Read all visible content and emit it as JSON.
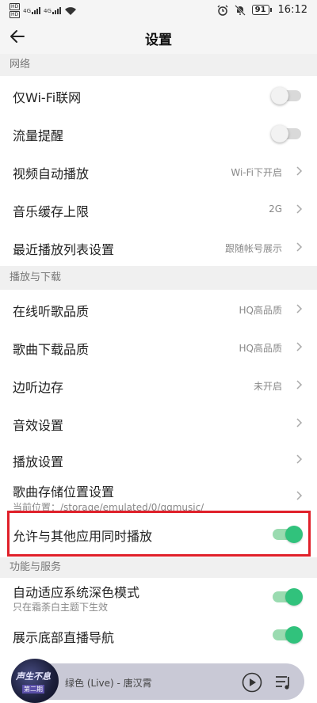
{
  "status_bar": {
    "hd1": "HD",
    "hd2": "HD",
    "net1": "4G",
    "net2": "4G",
    "battery": "91",
    "time": "16:12"
  },
  "header": {
    "title": "设置"
  },
  "sections": {
    "network": {
      "title": "网络",
      "wifi_only": {
        "label": "仅Wi-Fi联网",
        "enabled": false
      },
      "data_alert": {
        "label": "流量提醒",
        "enabled": false
      },
      "video_autoplay": {
        "label": "视频自动播放",
        "value": "Wi-Fi下开启"
      },
      "cache_limit": {
        "label": "音乐缓存上限",
        "value": "2G"
      },
      "recent_playlist": {
        "label": "最近播放列表设置",
        "value": "跟随帐号展示"
      }
    },
    "playback": {
      "title": "播放与下载",
      "online_quality": {
        "label": "在线听歌品质",
        "value": "HQ高品质"
      },
      "download_quality": {
        "label": "歌曲下载品质",
        "value": "HQ高品质"
      },
      "listen_cache": {
        "label": "边听边存",
        "value": "未开启"
      },
      "sound_effects": {
        "label": "音效设置"
      },
      "playback_settings": {
        "label": "播放设置"
      },
      "storage_location": {
        "label": "歌曲存储位置设置",
        "sub": "当前位置：/storage/emulated/0/qqmusic/"
      },
      "allow_other_apps": {
        "label": "允许与其他应用同时播放",
        "enabled": true
      }
    },
    "features": {
      "title": "功能与服务",
      "dark_mode": {
        "label": "自动适应系统深色模式",
        "sub": "只在霜荼白主题下生效",
        "enabled": true
      },
      "live_nav": {
        "label": "展示底部直播导航",
        "enabled": true
      }
    }
  },
  "player": {
    "song": "绿色 (Live) - 唐汉霄",
    "album_text1": "声生不息",
    "album_text2": "第二期"
  },
  "colors": {
    "accent_green": "#31c27c",
    "highlight_red": "#e0202a"
  }
}
